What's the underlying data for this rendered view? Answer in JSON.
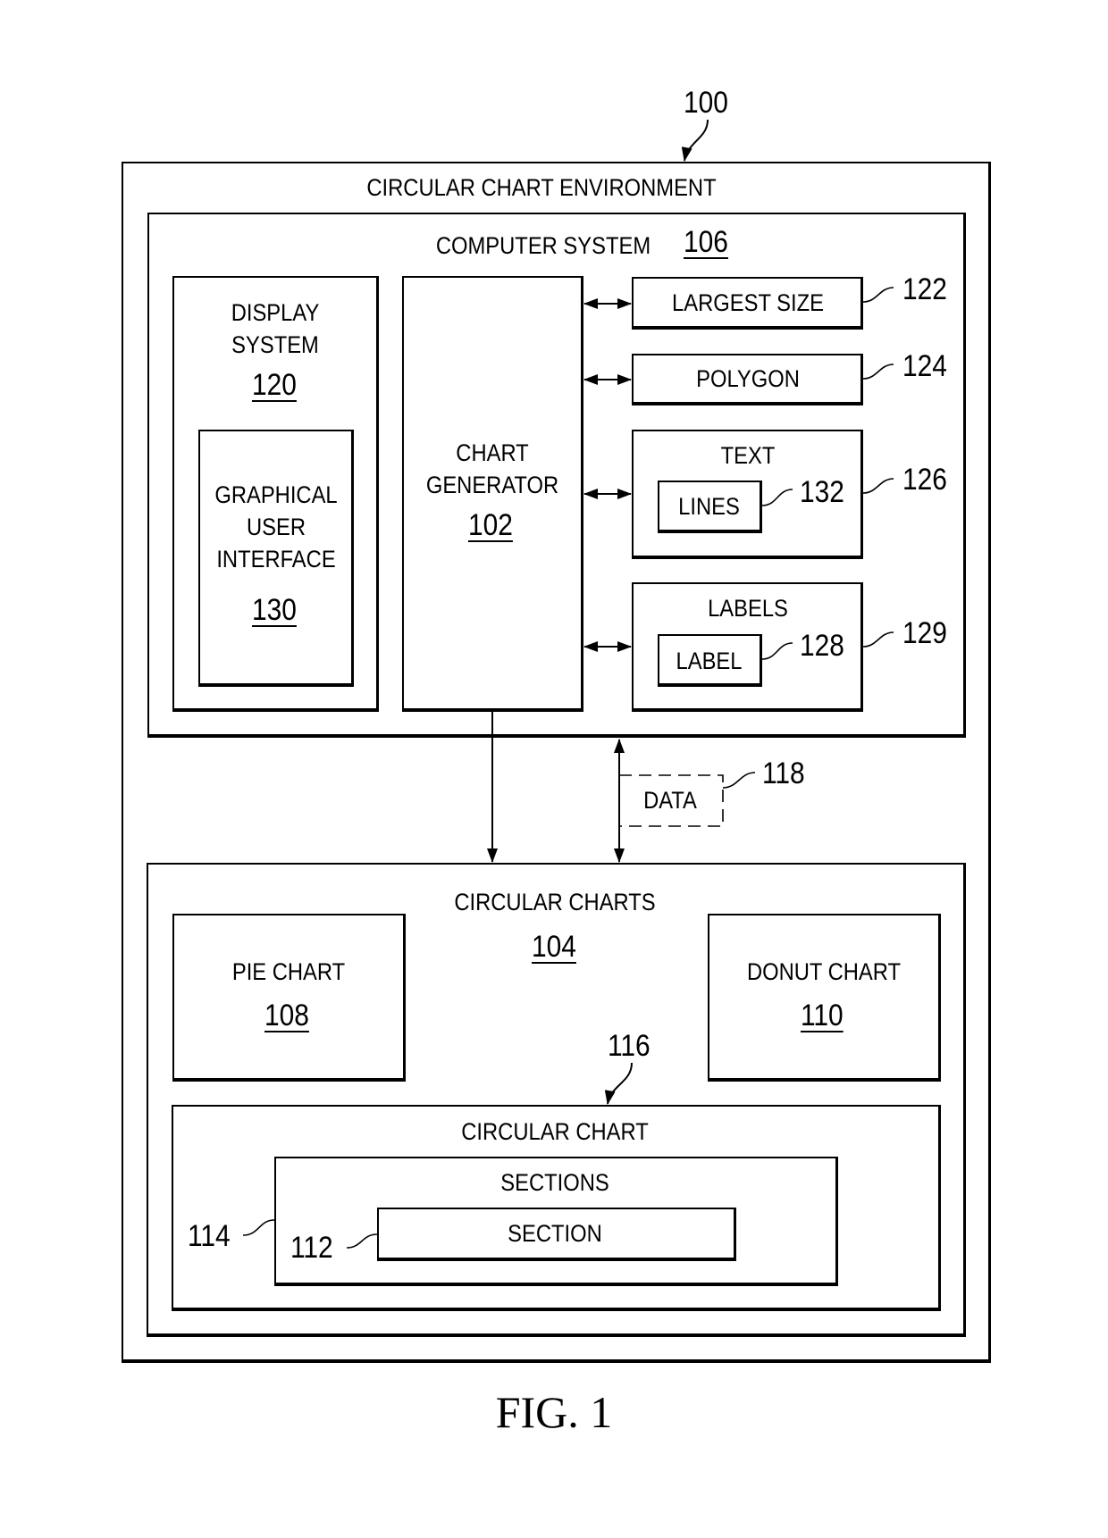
{
  "figure": {
    "caption": "FIG. 1",
    "ref": "100"
  },
  "environment": {
    "title": "CIRCULAR CHART ENVIRONMENT",
    "computer_system": {
      "title": "COMPUTER SYSTEM",
      "ref": "106",
      "display_system": {
        "title_line1": "DISPLAY",
        "title_line2": "SYSTEM",
        "ref": "120",
        "gui": {
          "line1": "GRAPHICAL",
          "line2": "USER",
          "line3": "INTERFACE",
          "ref": "130"
        }
      },
      "chart_generator": {
        "line1": "CHART",
        "line2": "GENERATOR",
        "ref": "102"
      },
      "components": {
        "largest_size": {
          "label": "LARGEST SIZE",
          "ref": "122"
        },
        "polygon": {
          "label": "POLYGON",
          "ref": "124"
        },
        "text": {
          "label": "TEXT",
          "ref": "126",
          "inner_label": "LINES",
          "inner_ref": "132"
        },
        "labels": {
          "label": "LABELS",
          "ref": "129",
          "inner_label": "LABEL",
          "inner_ref": "128"
        }
      }
    },
    "data": {
      "label": "DATA",
      "ref": "118"
    },
    "circular_charts": {
      "title": "CIRCULAR CHARTS",
      "ref": "104",
      "pie_chart": {
        "label": "PIE CHART",
        "ref": "108"
      },
      "donut_chart": {
        "label": "DONUT CHART",
        "ref": "110"
      },
      "circular_chart": {
        "title": "CIRCULAR CHART",
        "ref": "116",
        "sections": {
          "title": "SECTIONS",
          "ref": "114",
          "section": {
            "label": "SECTION",
            "ref": "112"
          }
        }
      }
    }
  }
}
